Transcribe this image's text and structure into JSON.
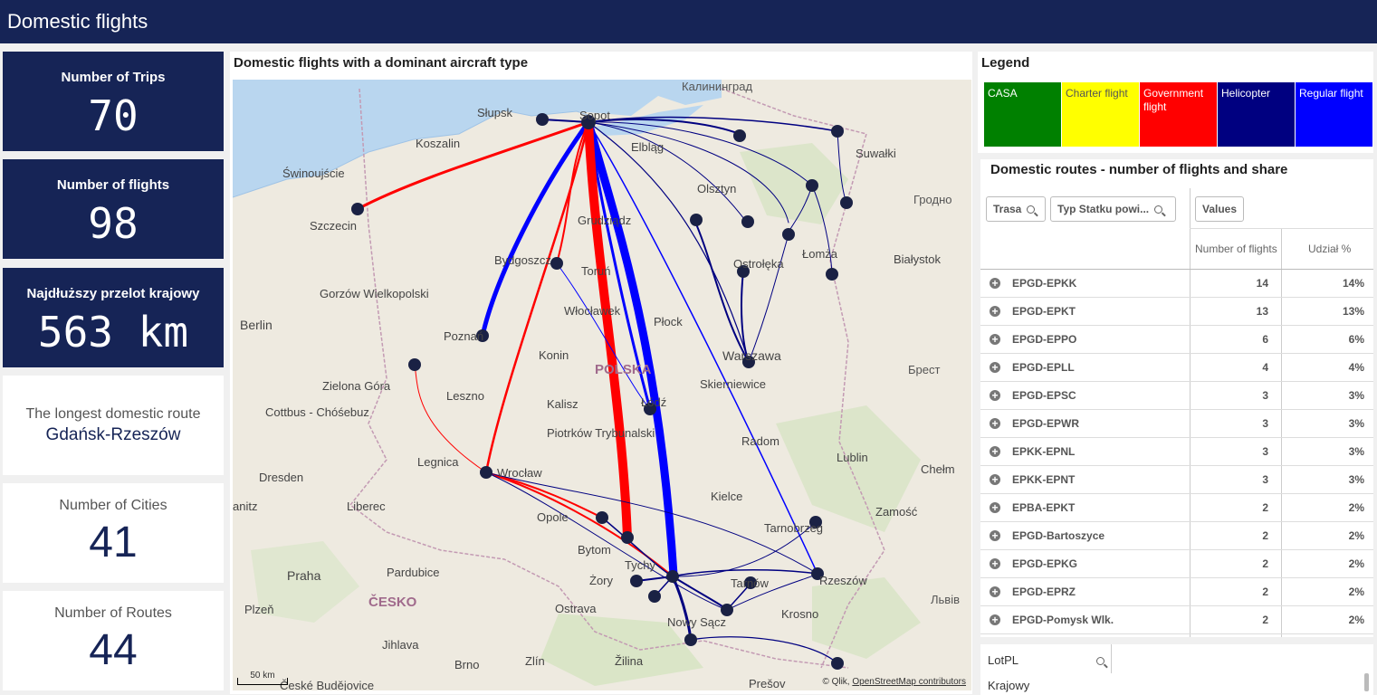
{
  "app": {
    "title": "Domestic flights"
  },
  "kpis": [
    {
      "label": "Number of Trips",
      "value": "70"
    },
    {
      "label": "Number of flights",
      "value": "98"
    },
    {
      "label": "Najdłuższy przelot krajowy",
      "value": "563 km"
    },
    {
      "label": "The longest domestic route",
      "value": "Gdańsk-Rzeszów"
    },
    {
      "label": "Number of Cities",
      "value": "41"
    },
    {
      "label": "Number of Routes",
      "value": "44"
    }
  ],
  "map": {
    "title": "Domestic flights with a dominant aircraft type",
    "scale": "50 km",
    "attribution_prefix": "© Qlik, ",
    "attribution_link": "OpenStreetMap contributors",
    "labels": {
      "kaliningrad": "Калининград",
      "slupsk": "Słupsk",
      "sopot": "Sopot",
      "koszalin": "Koszalin",
      "elblag": "Elbląg",
      "swinoujscie": "Świnoujście",
      "suwalki": "Suwałki",
      "olsztyn": "Olsztyn",
      "grodno": "Гродно",
      "szczecin": "Szczecin",
      "grudziadz": "Grudziądz",
      "lomza": "Łomża",
      "bydgoszcz": "Bydgoszcz",
      "torun": "Toruń",
      "ostroleka": "Ostrołęka",
      "bialystok": "Białystok",
      "gorzow": "Gorzów Wielkopolski",
      "berlin": "Berlin",
      "wloclawek": "Włocławek",
      "plock": "Płock",
      "poznan": "Poznań",
      "warszawa": "Warszawa",
      "konin": "Konin",
      "polska": "POLSKA",
      "brest": "Брест",
      "zielona": "Zielona Góra",
      "leszno": "Leszno",
      "skierniewice": "Skierniewice",
      "kalisz": "Kalisz",
      "lodz": "Łódź",
      "cottbus": "Cottbus - Chóśebuz",
      "piotrkow": "Piotrków Trybunalski",
      "radom": "Radom",
      "legnica": "Legnica",
      "lublin": "Lublin",
      "wroclaw": "Wrocław",
      "dresden": "Dresden",
      "chelm": "Chełm",
      "kielce": "Kielce",
      "liberec": "Liberec",
      "zamosc": "Zamość",
      "opole": "Opole",
      "anitz": "anitz",
      "tarnobrzeg": "Tarnobrzeg",
      "bytom": "Bytom",
      "praha": "Praha",
      "pardubice": "Pardubice",
      "zory": "Żory",
      "tychy": "Tychy",
      "tarnow": "Tarnów",
      "rzeszow": "Rzeszów",
      "lviv": "Львів",
      "plzen": "Plzeň",
      "cesko": "ČESKO",
      "ostrava": "Ostrava",
      "nowysacz": "Nowy Sącz",
      "krosno": "Krosno",
      "jihlava": "Jihlava",
      "brno": "Brno",
      "zlin": "Zlín",
      "zilina": "Žilina",
      "budejovice": "České Budějovice",
      "presov": "Prešov"
    }
  },
  "legend": {
    "title": "Legend",
    "items": [
      {
        "label": "CASA",
        "color": "#008000",
        "text_color": "#ffffff"
      },
      {
        "label": "Charter flight",
        "color": "#ffff00",
        "text_color": "#444444"
      },
      {
        "label": "Government flight",
        "color": "#ff0000",
        "text_color": "#ffffff"
      },
      {
        "label": "Helicopter",
        "color": "#000080",
        "text_color": "#ffffff"
      },
      {
        "label": "Regular flight",
        "color": "#0000ff",
        "text_color": "#ffffff"
      }
    ]
  },
  "routes_table": {
    "title": "Domestic routes - number of flights and share",
    "filter_trasa": "Trasa",
    "filter_typ": "Typ Statku powi...",
    "values_button": "Values",
    "col_flights": "Number of flights",
    "col_share": "Udział %",
    "rows": [
      {
        "route": "EPGD-EPKK",
        "flights": "14",
        "share": "14%"
      },
      {
        "route": "EPGD-EPKT",
        "flights": "13",
        "share": "13%"
      },
      {
        "route": "EPGD-EPPO",
        "flights": "6",
        "share": "6%"
      },
      {
        "route": "EPGD-EPLL",
        "flights": "4",
        "share": "4%"
      },
      {
        "route": "EPGD-EPSC",
        "flights": "3",
        "share": "3%"
      },
      {
        "route": "EPGD-EPWR",
        "flights": "3",
        "share": "3%"
      },
      {
        "route": "EPKK-EPNL",
        "flights": "3",
        "share": "3%"
      },
      {
        "route": "EPKK-EPNT",
        "flights": "3",
        "share": "3%"
      },
      {
        "route": "EPBA-EPKT",
        "flights": "2",
        "share": "2%"
      },
      {
        "route": "EPGD-Bartoszyce",
        "flights": "2",
        "share": "2%"
      },
      {
        "route": "EPGD-EPKG",
        "flights": "2",
        "share": "2%"
      },
      {
        "route": "EPGD-EPRZ",
        "flights": "2",
        "share": "2%"
      },
      {
        "route": "EPGD-Pomysk Wlk.",
        "flights": "2",
        "share": "2%"
      }
    ]
  },
  "filter": {
    "label": "LotPL",
    "item": "Krajowy"
  }
}
